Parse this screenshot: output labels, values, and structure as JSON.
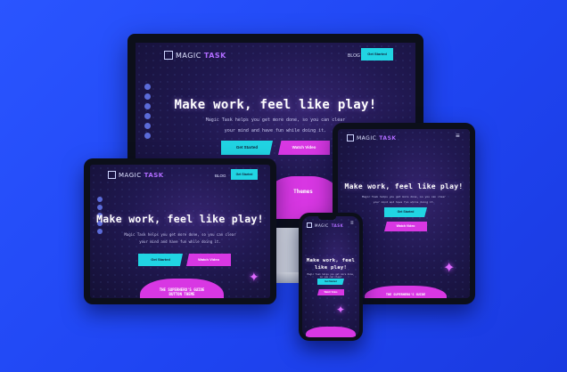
{
  "site": {
    "logo_a": "MAGIC",
    "logo_b": "TASK",
    "nav_blog": "BLOG",
    "nav_cta": "Get Started",
    "hero_title": "Make work, feel like play!",
    "hero_sub_line1": "Magic Task helps you get more done, so you can clear",
    "hero_sub_line2": "your mind and have fun while doing it.",
    "btn_primary": "Get Started",
    "btn_secondary": "Watch Video",
    "themes_badge": "Themes",
    "themes_title": "THE SUPERHERO'S GUIDE",
    "themes_sub": "BUTTON THEME"
  },
  "colors": {
    "background": "#2a55ff",
    "accent_cyan": "#21d4e3",
    "accent_magenta": "#d837e3",
    "logo_accent": "#b06bff"
  },
  "icons": [
    "menu-icon",
    "sparkle-icon",
    "social-icons"
  ]
}
